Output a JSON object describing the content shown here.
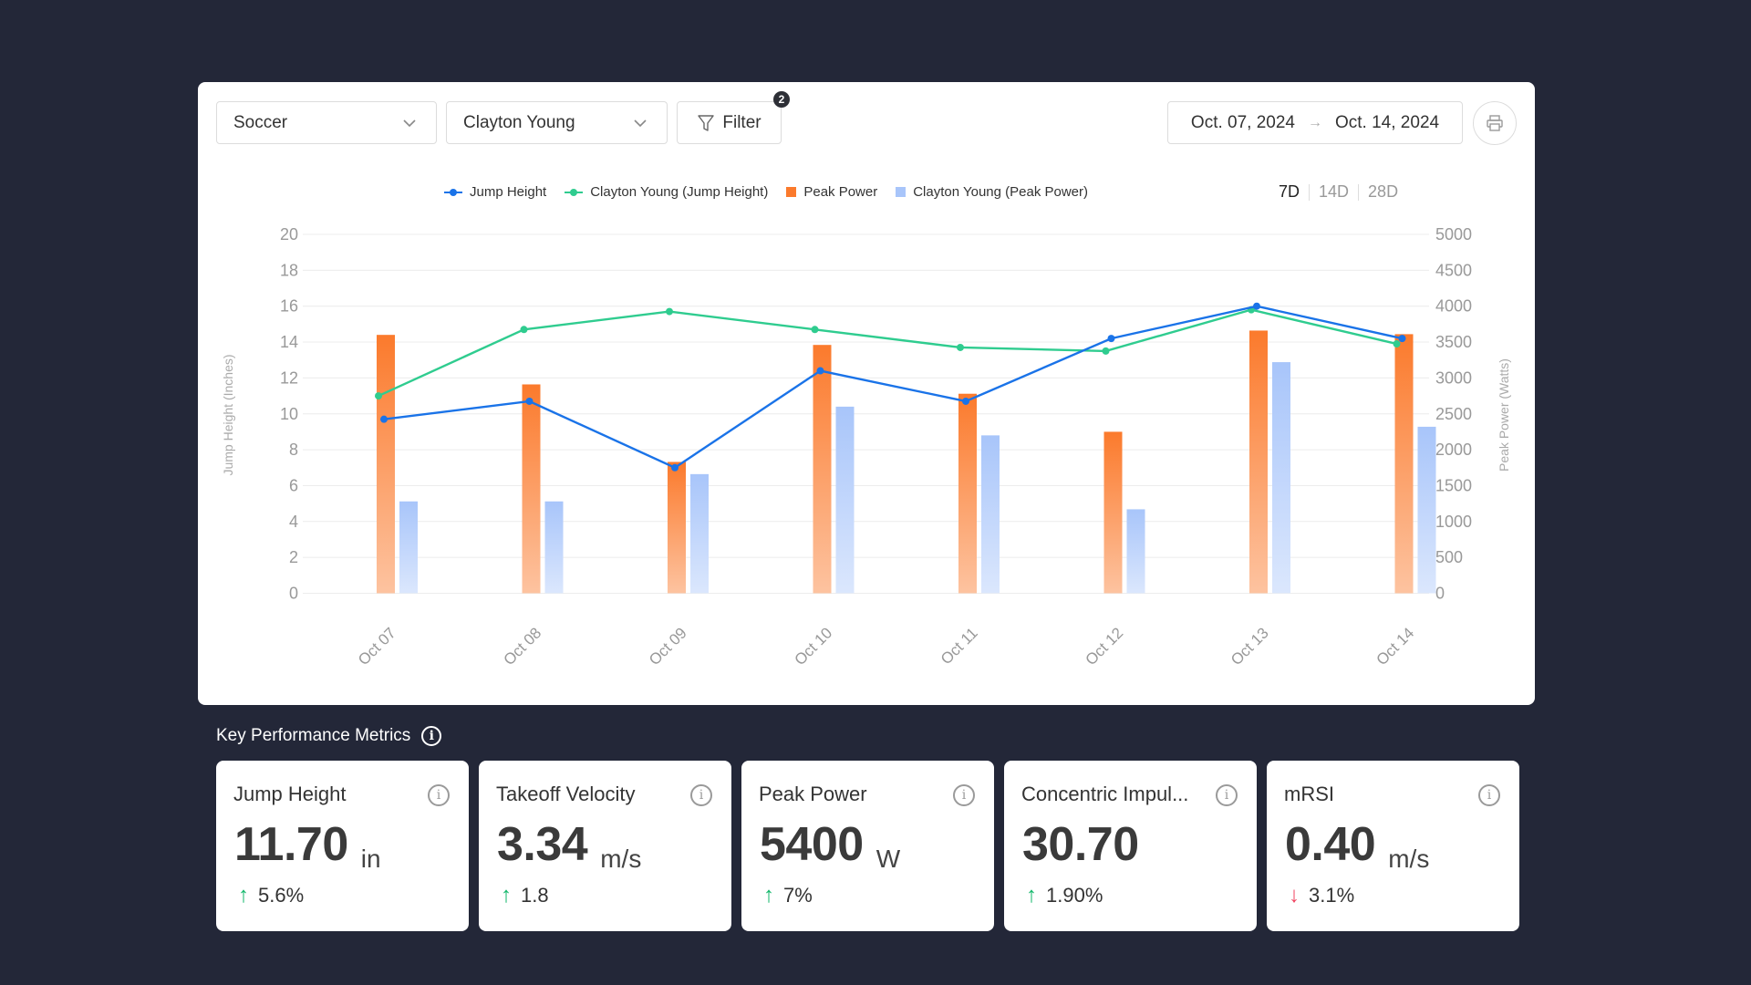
{
  "toolbar": {
    "sport_select": "Soccer",
    "athlete_select": "Clayton Young",
    "filter_label": "Filter",
    "filter_count": "2",
    "date_start": "Oct. 07, 2024",
    "date_end": "Oct. 14, 2024",
    "date_arrow": "→",
    "print_icon": "printer-icon"
  },
  "range_tabs": [
    {
      "label": "7D",
      "active": true
    },
    {
      "label": "14D",
      "active": false
    },
    {
      "label": "28D",
      "active": false
    }
  ],
  "colors": {
    "jump_height": "#1a73e8",
    "clayton_jump_height": "#2fcc8f",
    "peak_power": "#fb7a2c",
    "clayton_peak_power": "#a8c5fa",
    "positive": "#12b76a",
    "negative": "#f04461"
  },
  "chart_data": {
    "type": "bar",
    "categories": [
      "Oct 07",
      "Oct 08",
      "Oct 09",
      "Oct 10",
      "Oct 11",
      "Oct 12",
      "Oct 13",
      "Oct 14"
    ],
    "series": [
      {
        "name": "Jump Height",
        "type": "line",
        "axis": "left",
        "values": [
          9.7,
          10.7,
          7.0,
          12.4,
          10.7,
          14.2,
          16.0,
          14.2
        ]
      },
      {
        "name": "Clayton Young (Jump Height)",
        "type": "line",
        "axis": "left",
        "values": [
          11.0,
          14.7,
          15.7,
          14.7,
          13.7,
          13.5,
          15.8,
          13.9
        ]
      },
      {
        "name": "Peak Power",
        "type": "bar",
        "axis": "right",
        "values": [
          3600,
          2910,
          1830,
          3460,
          2780,
          2250,
          3660,
          3610
        ]
      },
      {
        "name": "Clayton Young (Peak Power)",
        "type": "bar",
        "axis": "right",
        "values": [
          1280,
          1280,
          1660,
          2600,
          2200,
          1170,
          3220,
          2320
        ]
      }
    ],
    "ylabel_left": "Jump Height (Inches)",
    "ylabel_right": "Peak Power (Watts)",
    "ylim_left": [
      0,
      20
    ],
    "ylim_right": [
      0,
      5000
    ],
    "yticks_left": [
      "0",
      "2",
      "4",
      "6",
      "8",
      "10",
      "12",
      "14",
      "16",
      "18",
      "20"
    ],
    "yticks_right": [
      "0",
      "500",
      "1000",
      "1500",
      "2000",
      "2500",
      "3000",
      "3500",
      "4000",
      "4500",
      "5000"
    ],
    "grid": true,
    "legend_position": "top-center"
  },
  "kpi": {
    "title": "Key Performance Metrics",
    "cards": [
      {
        "name": "Jump Height",
        "value": "11.70",
        "unit": "in",
        "delta": "5.6%",
        "direction": "up",
        "arrow": "↑"
      },
      {
        "name": "Takeoff Velocity",
        "value": "3.34",
        "unit": "m/s",
        "delta": "1.8",
        "direction": "up",
        "arrow": "↑"
      },
      {
        "name": "Peak Power",
        "value": "5400",
        "unit": "W",
        "delta": "7%",
        "direction": "up",
        "arrow": "↑"
      },
      {
        "name": "Concentric Impul...",
        "value": "30.70",
        "unit": "",
        "delta": "1.90%",
        "direction": "up",
        "arrow": "↑"
      },
      {
        "name": "mRSI",
        "value": "0.40",
        "unit": "m/s",
        "delta": "3.1%",
        "direction": "down",
        "arrow": "↓"
      }
    ]
  }
}
